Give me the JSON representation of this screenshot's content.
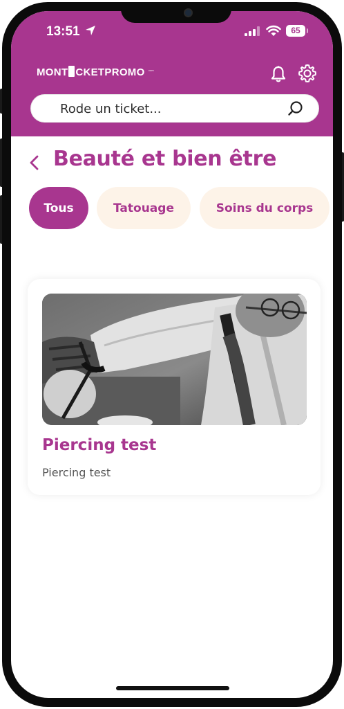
{
  "status_bar": {
    "time": "13:51",
    "battery": "65",
    "icons": [
      "location-arrow-icon",
      "signal-icon",
      "wifi-icon",
      "battery-icon"
    ]
  },
  "header": {
    "logo_text_1": "MONT",
    "logo_text_2": "CKETPROMO",
    "logo_suffix": "com",
    "icons": [
      "bell-icon",
      "gear-icon"
    ],
    "color": "#a8368f"
  },
  "search": {
    "placeholder": "Rode un ticket...",
    "value": ""
  },
  "page": {
    "title": "Beauté et bien être",
    "back_icon": "chevron-left-icon"
  },
  "chips": [
    {
      "label": "Tous",
      "active": true
    },
    {
      "label": "Tatouage",
      "active": false
    },
    {
      "label": "Soins du corps",
      "active": false
    }
  ],
  "cards": [
    {
      "title": "Piercing test",
      "subtitle": "Piercing test",
      "image": "black-and-white photo of piercing artist at work"
    }
  ],
  "colors": {
    "brand": "#a8368f",
    "chip_inactive_bg": "#fdf3e8",
    "background": "#ffffff"
  }
}
